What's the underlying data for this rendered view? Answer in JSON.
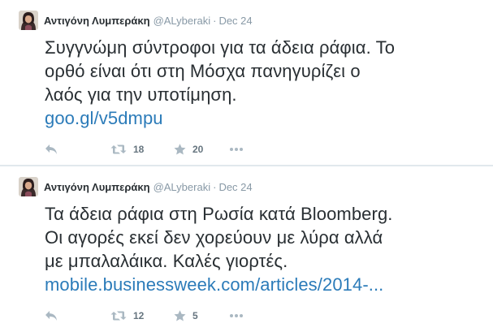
{
  "tweets": [
    {
      "fullname": "Αντιγόνη Λυμπεράκη",
      "username": "@ALyberaki",
      "separator": "·",
      "time": "Dec 24",
      "text_lines": [
        "Συγγνώμη σύντροφοι για τα άδεια ράφια. Το",
        "ορθό είναι ότι στη Μόσχα πανηγυρίζει ο",
        "λαός για την υποτίμηση."
      ],
      "link": "goo.gl/v5dmpu",
      "retweets": "18",
      "favorites": "20"
    },
    {
      "fullname": "Αντιγόνη Λυμπεράκη",
      "username": "@ALyberaki",
      "separator": "·",
      "time": "Dec 24",
      "text_lines": [
        "Τα άδεια ράφια στη Ρωσία κατά Bloomberg.",
        "Οι αγορές εκεί δεν χορεύουν με λύρα αλλά",
        "με μπαλαλάικα.  Καλές γιορτές."
      ],
      "link": "mobile.businessweek.com/articles/2014-...",
      "retweets": "12",
      "favorites": "5"
    }
  ],
  "icons": {
    "reply": "reply-icon",
    "retweet": "retweet-icon",
    "favorite": "star-icon",
    "more": "more-dots-icon"
  },
  "colors": {
    "link": "#2b7bb9",
    "meta": "#8899a6",
    "action": "#aab8c2",
    "text": "#292f33"
  }
}
